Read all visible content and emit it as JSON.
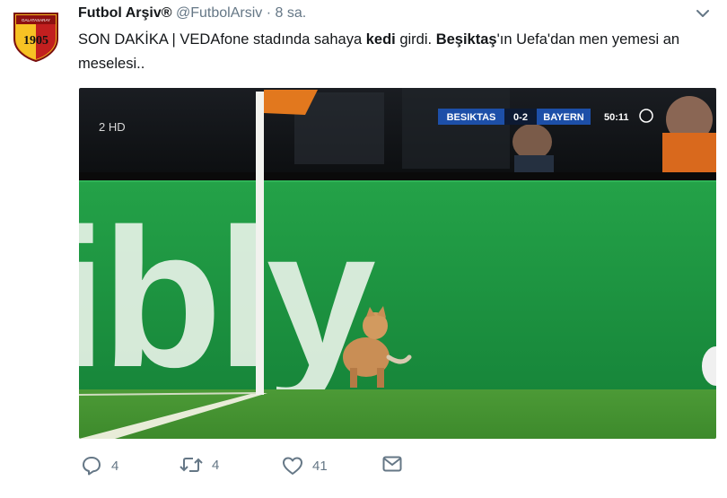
{
  "tweet": {
    "author_name": "Futbol Arşiv®",
    "handle": "@FutbolArsiv",
    "separator": "·",
    "time": "8 sa.",
    "text_p1": "SON DAKİKA | VEDAfone stadında sahaya ",
    "text_b1": "kedi",
    "text_p2": " girdi. ",
    "text_b2": "Beşiktaş",
    "text_p3": "'ın Uefa'dan men yemesi an meselesi.."
  },
  "avatar": {
    "top_text": "GALATASARAY",
    "year": "1905"
  },
  "media": {
    "tv_channel": "2 HD",
    "score": {
      "home": "BESIKTAS",
      "result": "0-2",
      "away": "BAYERN",
      "clock": "50:11"
    },
    "board_text": "ibly"
  },
  "actions": {
    "reply_count": "4",
    "retweet_count": "4",
    "like_count": "41"
  },
  "colors": {
    "text": "#14171a",
    "muted": "#657786",
    "pitch": "#3c8f2a",
    "board": "#1f9a3e"
  },
  "icons": [
    "chevron-down-icon",
    "reply-icon",
    "retweet-icon",
    "like-icon",
    "message-icon"
  ]
}
